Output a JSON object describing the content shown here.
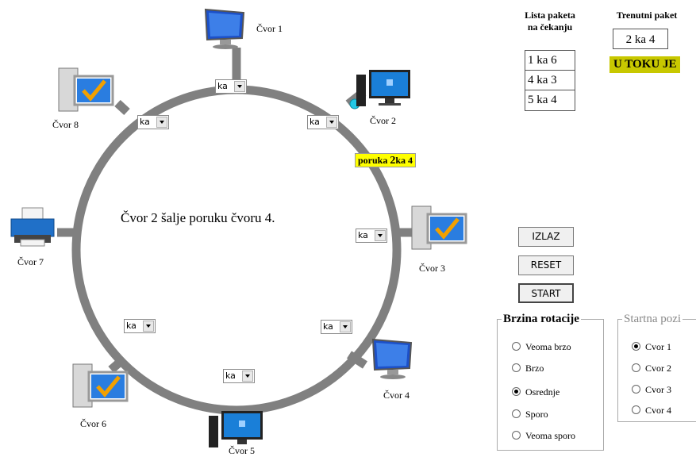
{
  "nodes": [
    {
      "label": "Čvor 1",
      "icon": "monitor-icon"
    },
    {
      "label": "Čvor 2",
      "icon": "desktop-icon"
    },
    {
      "label": "Čvor 3",
      "icon": "tower-icon"
    },
    {
      "label": "Čvor 4",
      "icon": "monitor-icon"
    },
    {
      "label": "Čvor 5",
      "icon": "desktop-icon"
    },
    {
      "label": "Čvor 6",
      "icon": "tower-icon"
    },
    {
      "label": "Čvor 7",
      "icon": "printer-icon"
    },
    {
      "label": "Čvor 8",
      "icon": "tower-icon"
    }
  ],
  "combo_value": "ka",
  "center_message": "Čvor 2 šalje poruku čvoru 4.",
  "message_tag": {
    "prefix": "poruka ",
    "from": "2",
    "middle": "ka ",
    "to": "4"
  },
  "queue": {
    "header_line1": "Lista paketa",
    "header_line2": "na čekanju",
    "items": [
      "1  ka  6",
      "4  ka  3",
      "5  ka  4"
    ]
  },
  "current": {
    "header": "Trenutni paket",
    "value": "2  ka  4",
    "status": "U TOKU JE"
  },
  "buttons": {
    "exit": "IZLAZ",
    "reset": "RESET",
    "start": "START"
  },
  "speed": {
    "title": "Brzina rotacije",
    "options": [
      "Veoma brzo",
      "Brzo",
      "Osrednje",
      "Sporo",
      "Veoma sporo"
    ],
    "selected": "Osrednje"
  },
  "start_pos": {
    "title": "Startna pozi",
    "options": [
      "Cvor 1",
      "Cvor 2",
      "Cvor 3",
      "Cvor 4"
    ],
    "selected": "Cvor 1"
  },
  "colors": {
    "ring": "#808080",
    "highlight": "#ffff00",
    "status_bg": "#c8c800"
  }
}
